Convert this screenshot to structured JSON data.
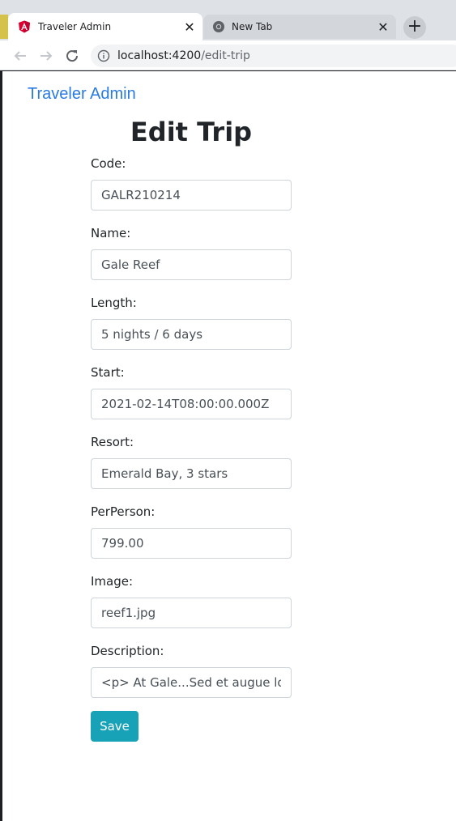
{
  "browser": {
    "tabs": [
      {
        "title": "Traveler Admin",
        "icon": "angular-icon",
        "active": true
      },
      {
        "title": "New Tab",
        "icon": "chrome-icon",
        "active": false
      }
    ],
    "new_tab_label": "+",
    "close_glyph": "✕",
    "url_host": "localhost:4200",
    "url_path": "/edit-trip"
  },
  "navbar": {
    "brand": "Traveler Admin"
  },
  "page": {
    "title": "Edit Trip"
  },
  "form": {
    "fields": [
      {
        "label": "Code:",
        "value": "GALR210214"
      },
      {
        "label": "Name:",
        "value": "Gale Reef"
      },
      {
        "label": "Length:",
        "value": "5 nights / 6 days"
      },
      {
        "label": "Start:",
        "value": "2021-02-14T08:00:00.000Z"
      },
      {
        "label": "Resort:",
        "value": "Emerald Bay, 3 stars"
      },
      {
        "label": "PerPerson:",
        "value": "799.00"
      },
      {
        "label": "Image:",
        "value": "reef1.jpg"
      },
      {
        "label": "Description:",
        "value": "<p> At Gale...Sed et augue lore"
      }
    ],
    "save_label": "Save"
  },
  "colors": {
    "brand_link": "#2a7ae2",
    "save_button": "#17a2b8",
    "angular_red": "#dd0031"
  }
}
